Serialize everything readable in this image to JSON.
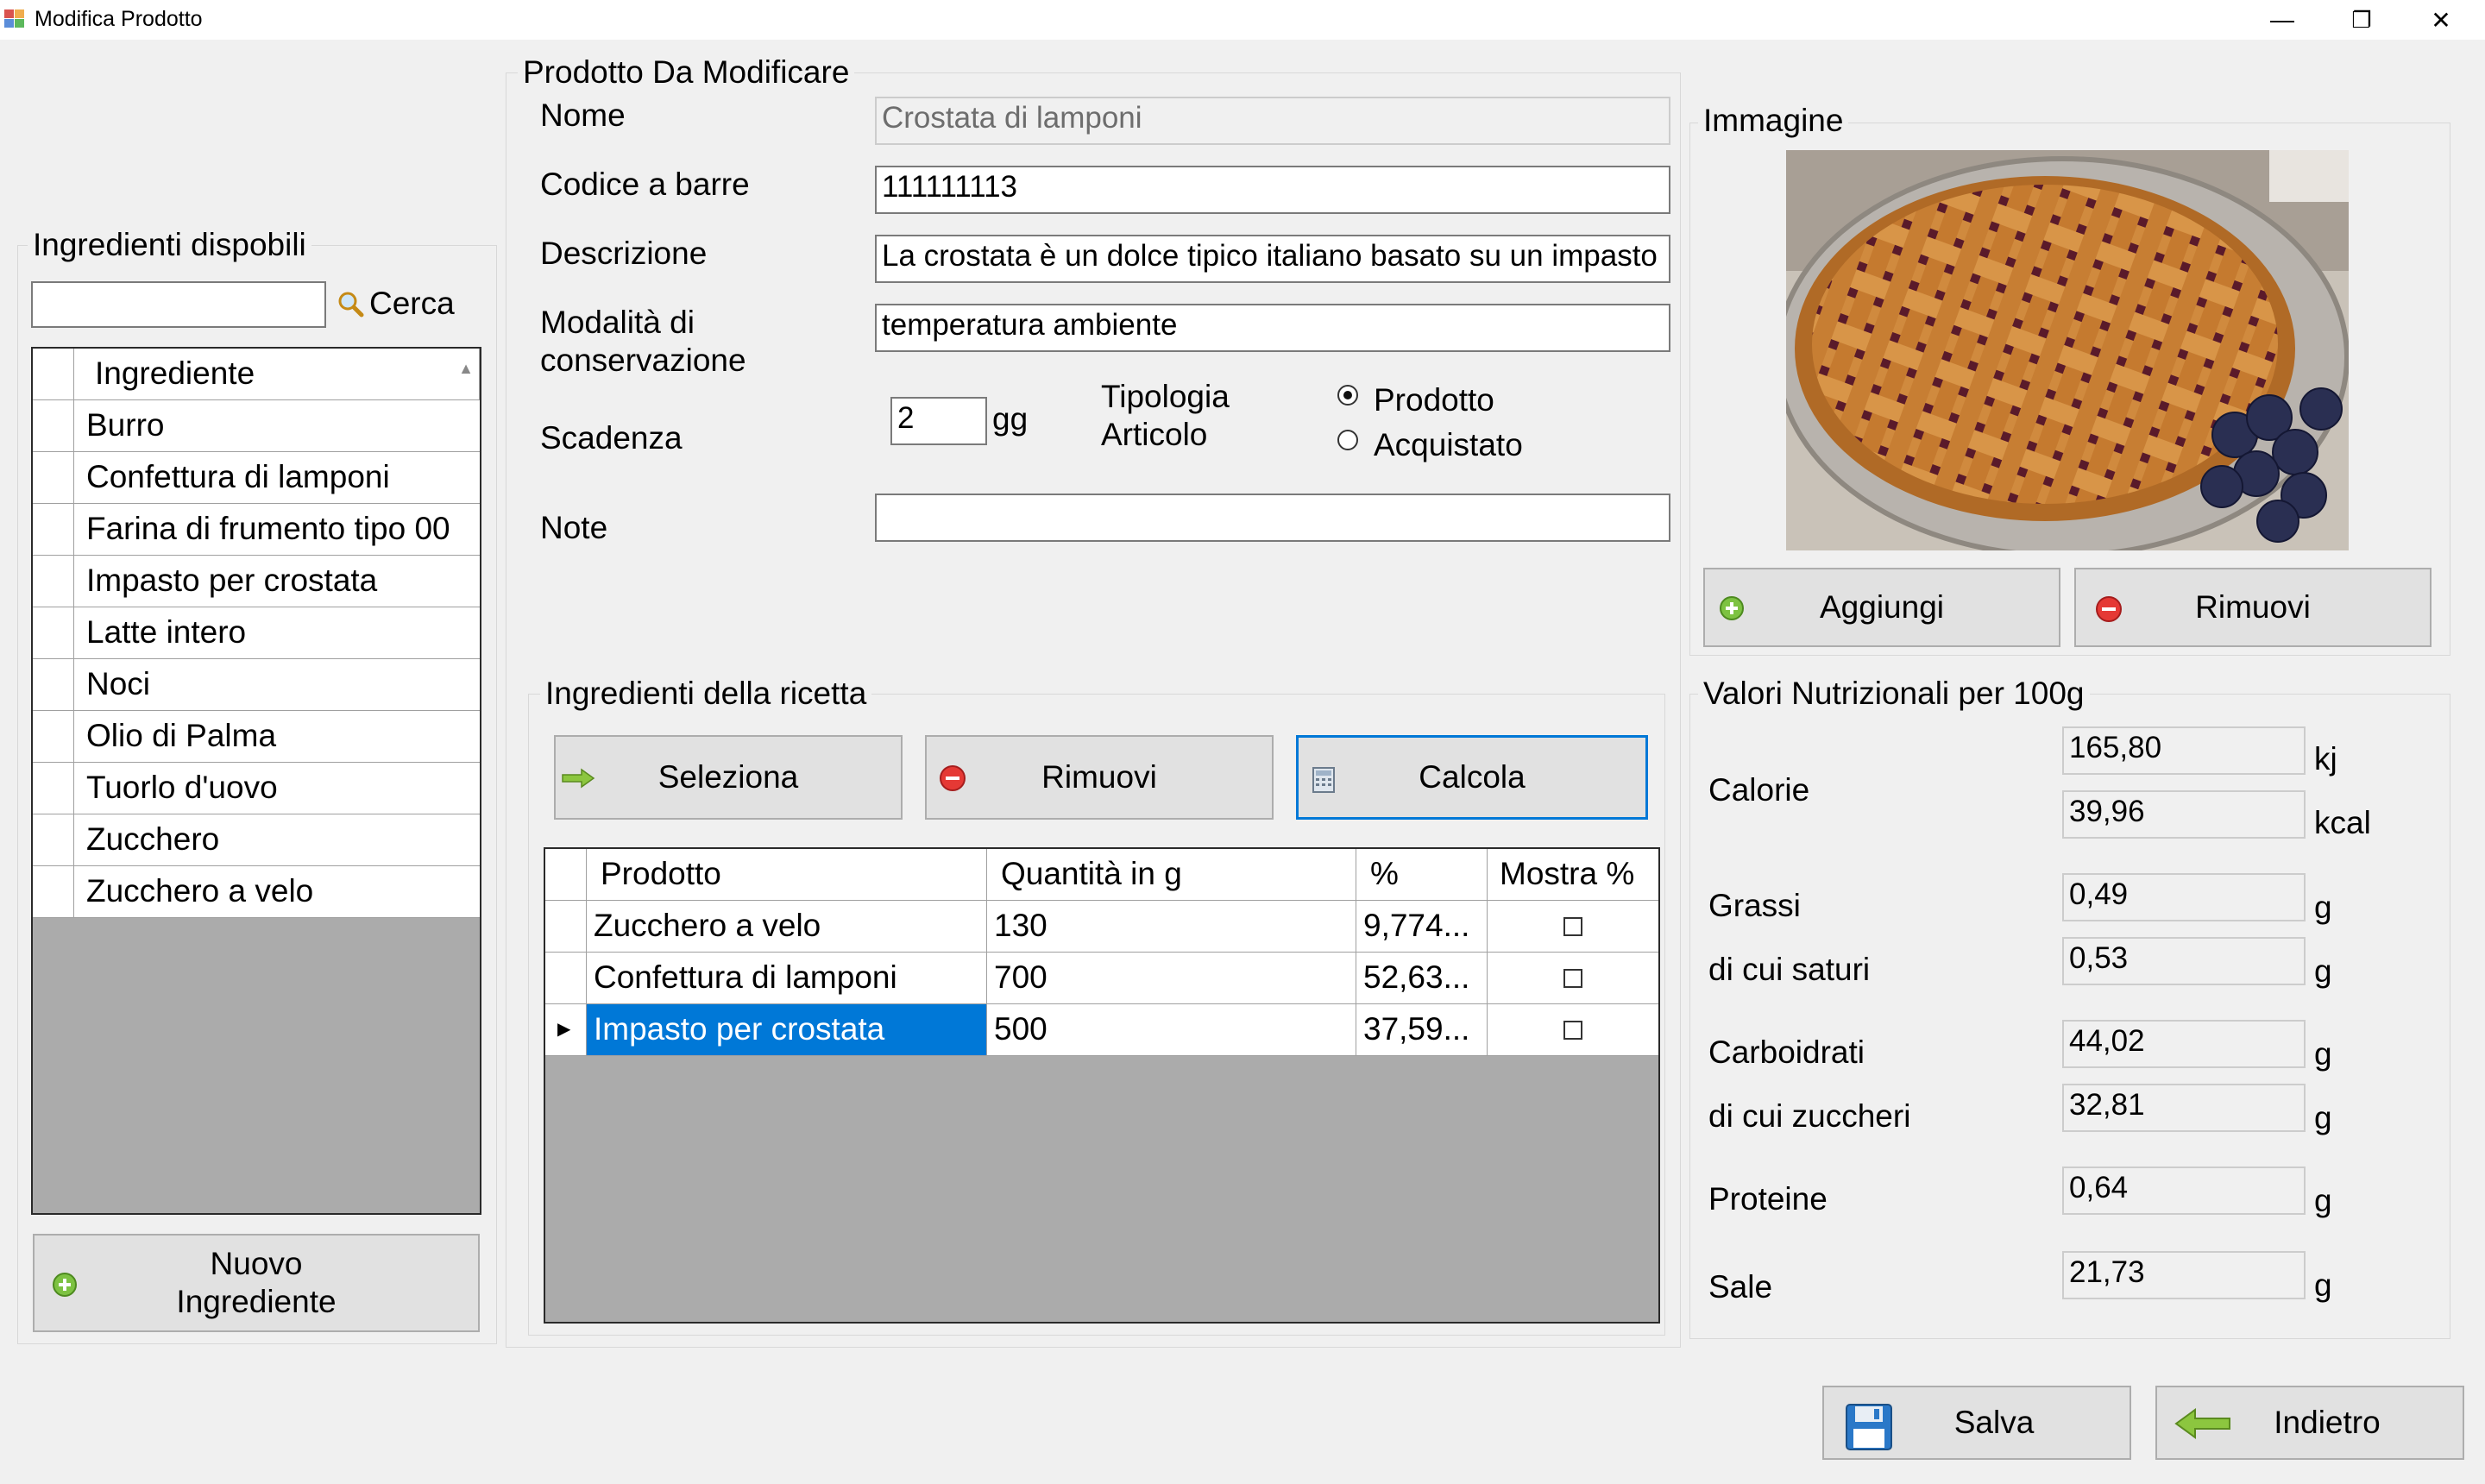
{
  "window": {
    "title": "Modifica Prodotto",
    "controls": [
      "—",
      "❐",
      "✕"
    ]
  },
  "ingredients_panel": {
    "title": "Ingredienti dispobili",
    "search_value": "",
    "search_label": "Cerca",
    "column": "Ingrediente",
    "items": [
      "Burro",
      "Confettura di lamponi",
      "Farina di frumento tipo 00",
      "Impasto per crostata",
      "Latte intero",
      "Noci",
      "Olio di Palma",
      "Tuorlo d'uovo",
      "Zucchero",
      "Zucchero a velo"
    ],
    "new_button": "Nuovo\nIngrediente"
  },
  "product": {
    "title": "Prodotto Da Modificare",
    "name_label": "Nome",
    "name_value": "Crostata di lamponi",
    "barcode_label": "Codice a barre",
    "barcode_value": "111111113",
    "description_label": "Descrizione",
    "description_value": "La crostata è un dolce tipico italiano basato su un impasto",
    "storage_label": "Modalità di\nconservazione",
    "storage_value": "temperatura ambiente",
    "expiry_label": "Scadenza",
    "expiry_value": "2",
    "expiry_unit": "gg",
    "type_label": "Tipologia\nArticolo",
    "type_options": [
      "Prodotto",
      "Acquistato"
    ],
    "type_selected": "Prodotto",
    "notes_label": "Note",
    "notes_value": ""
  },
  "recipe": {
    "title": "Ingredienti della ricetta",
    "buttons": {
      "select": "Seleziona",
      "remove": "Rimuovi",
      "calculate": "Calcola"
    },
    "columns": [
      "Prodotto",
      "Quantità in g",
      "%",
      "Mostra %"
    ],
    "rows": [
      {
        "product": "Zucchero a velo",
        "quantity": "130",
        "percent": "9,774...",
        "show": false
      },
      {
        "product": "Confettura di lamponi",
        "quantity": "700",
        "percent": "52,63...",
        "show": false
      },
      {
        "product": "Impasto per crostata",
        "quantity": "500",
        "percent": "37,59...",
        "show": false
      }
    ],
    "selected_row": 2
  },
  "image_panel": {
    "title": "Immagine",
    "add_button": "Aggiungi",
    "remove_button": "Rimuovi"
  },
  "nutrition": {
    "title": "Valori Nutrizionali per 100g",
    "calories_label": "Calorie",
    "calories_kj": "165,80",
    "kj_unit": "kj",
    "calories_kcal": "39,96",
    "kcal_unit": "kcal",
    "items": [
      {
        "label": "Grassi",
        "value": "0,49",
        "unit": "g"
      },
      {
        "label": "di cui saturi",
        "value": "0,53",
        "unit": "g"
      },
      {
        "label": "Carboidrati",
        "value": "44,02",
        "unit": "g"
      },
      {
        "label": "di cui zuccheri",
        "value": "32,81",
        "unit": "g"
      },
      {
        "label": "Proteine",
        "value": "0,64",
        "unit": "g"
      },
      {
        "label": "Sale",
        "value": "21,73",
        "unit": "g"
      }
    ]
  },
  "footer": {
    "save": "Salva",
    "back": "Indietro"
  },
  "colors": {
    "selection": "#0078d7",
    "focus_border": "#0078d7",
    "grid_background": "#ababab"
  }
}
